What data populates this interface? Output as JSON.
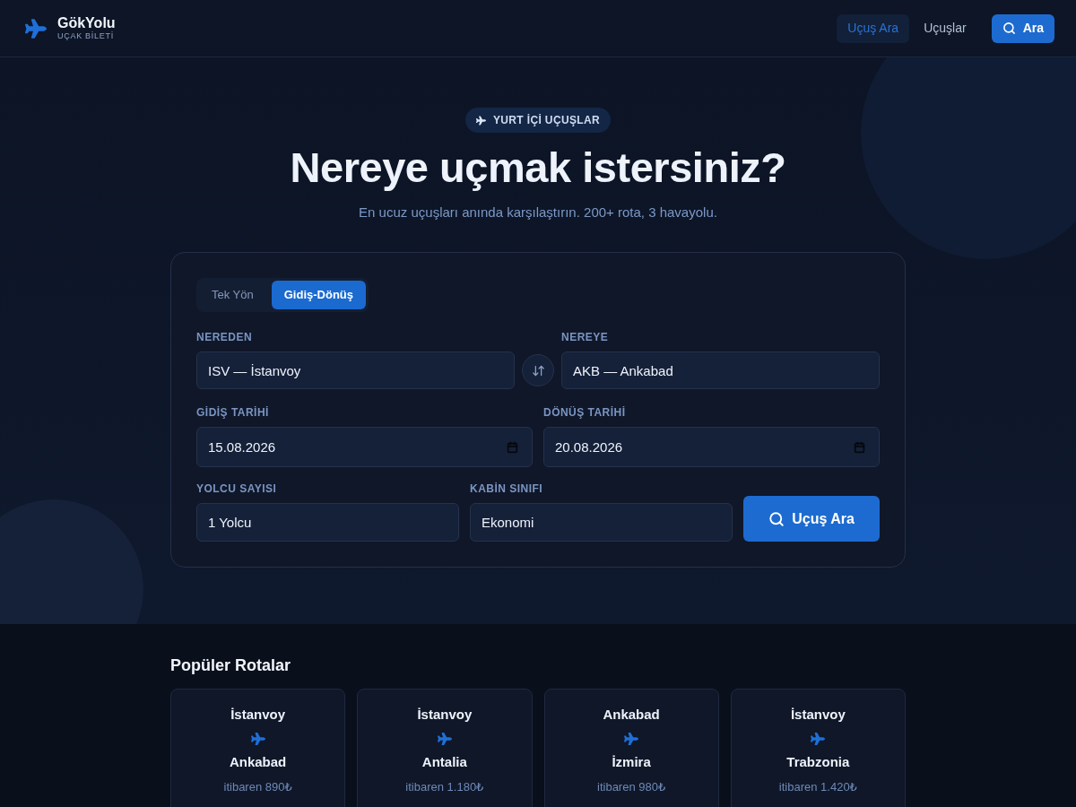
{
  "header": {
    "logo": {
      "name": "GökYolu",
      "tagline": "UÇAK BİLETİ"
    },
    "nav": [
      {
        "label": "Uçuş Ara",
        "selected": true
      },
      {
        "label": "Uçuşlar",
        "selected": false
      }
    ],
    "search_button": "Ara"
  },
  "hero": {
    "badge": "YURT İÇİ UÇUŞLAR",
    "title": "Nereye uçmak istersiniz?",
    "subtitle": "En ucuz uçuşları anında karşılaştırın. 200+ rota, 3 havayolu."
  },
  "search_form": {
    "trip_types": [
      {
        "label": "Tek Yön",
        "selected": false
      },
      {
        "label": "Gidiş-Dönüş",
        "selected": true
      }
    ],
    "from": {
      "label": "NEREDEN",
      "value": "ISV — İstanvoy"
    },
    "to": {
      "label": "NEREYE",
      "value": "AKB — Ankabad"
    },
    "departure_date": {
      "label": "GİDİŞ TARİHİ",
      "value": "15.08.2026"
    },
    "return_date": {
      "label": "DÖNÜŞ TARİHİ",
      "value": "20.08.2026"
    },
    "passengers": {
      "label": "YOLCU SAYISI",
      "value": "1 Yolcu"
    },
    "cabin_class": {
      "label": "KABİN SINIFI",
      "value": "Ekonomi"
    },
    "submit": "Uçuş Ara"
  },
  "popular_routes": {
    "title": "Popüler Rotalar",
    "routes": [
      {
        "from": "İstanvoy",
        "to": "Ankabad",
        "price": "itibaren 890₺"
      },
      {
        "from": "İstanvoy",
        "to": "Antalia",
        "price": "itibaren 1.180₺"
      },
      {
        "from": "Ankabad",
        "to": "İzmira",
        "price": "itibaren 980₺"
      },
      {
        "from": "İstanvoy",
        "to": "Trabzonia",
        "price": "itibaren 1.420₺"
      }
    ]
  }
}
